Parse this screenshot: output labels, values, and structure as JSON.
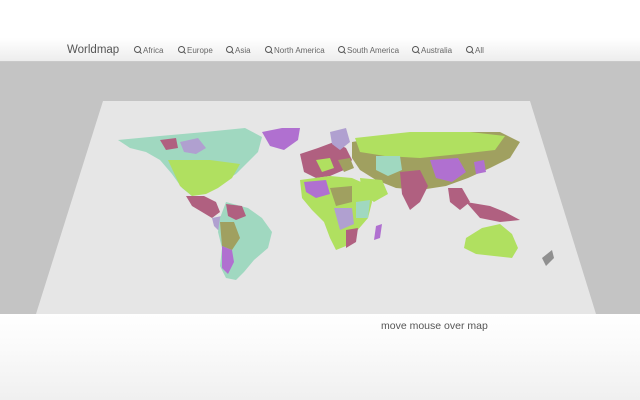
{
  "header": {
    "brand": "Worldmap",
    "nav": [
      {
        "label": "Africa",
        "icon": "zoom-in-icon"
      },
      {
        "label": "Europe",
        "icon": "zoom-in-icon"
      },
      {
        "label": "Asia",
        "icon": "zoom-in-icon"
      },
      {
        "label": "North America",
        "icon": "zoom-in-icon"
      },
      {
        "label": "South America",
        "icon": "zoom-in-icon"
      },
      {
        "label": "Australia",
        "icon": "zoom-in-icon"
      },
      {
        "label": "All",
        "icon": "zoom-in-icon"
      }
    ]
  },
  "map": {
    "background_color": "#c4c4c4",
    "plane_color": "#e6e6e6",
    "region_colors": [
      "#b0e060",
      "#b070d0",
      "#a0d8c0",
      "#b06080",
      "#a0a060",
      "#b0a0d0"
    ]
  },
  "status": {
    "text": "move mouse over map"
  }
}
